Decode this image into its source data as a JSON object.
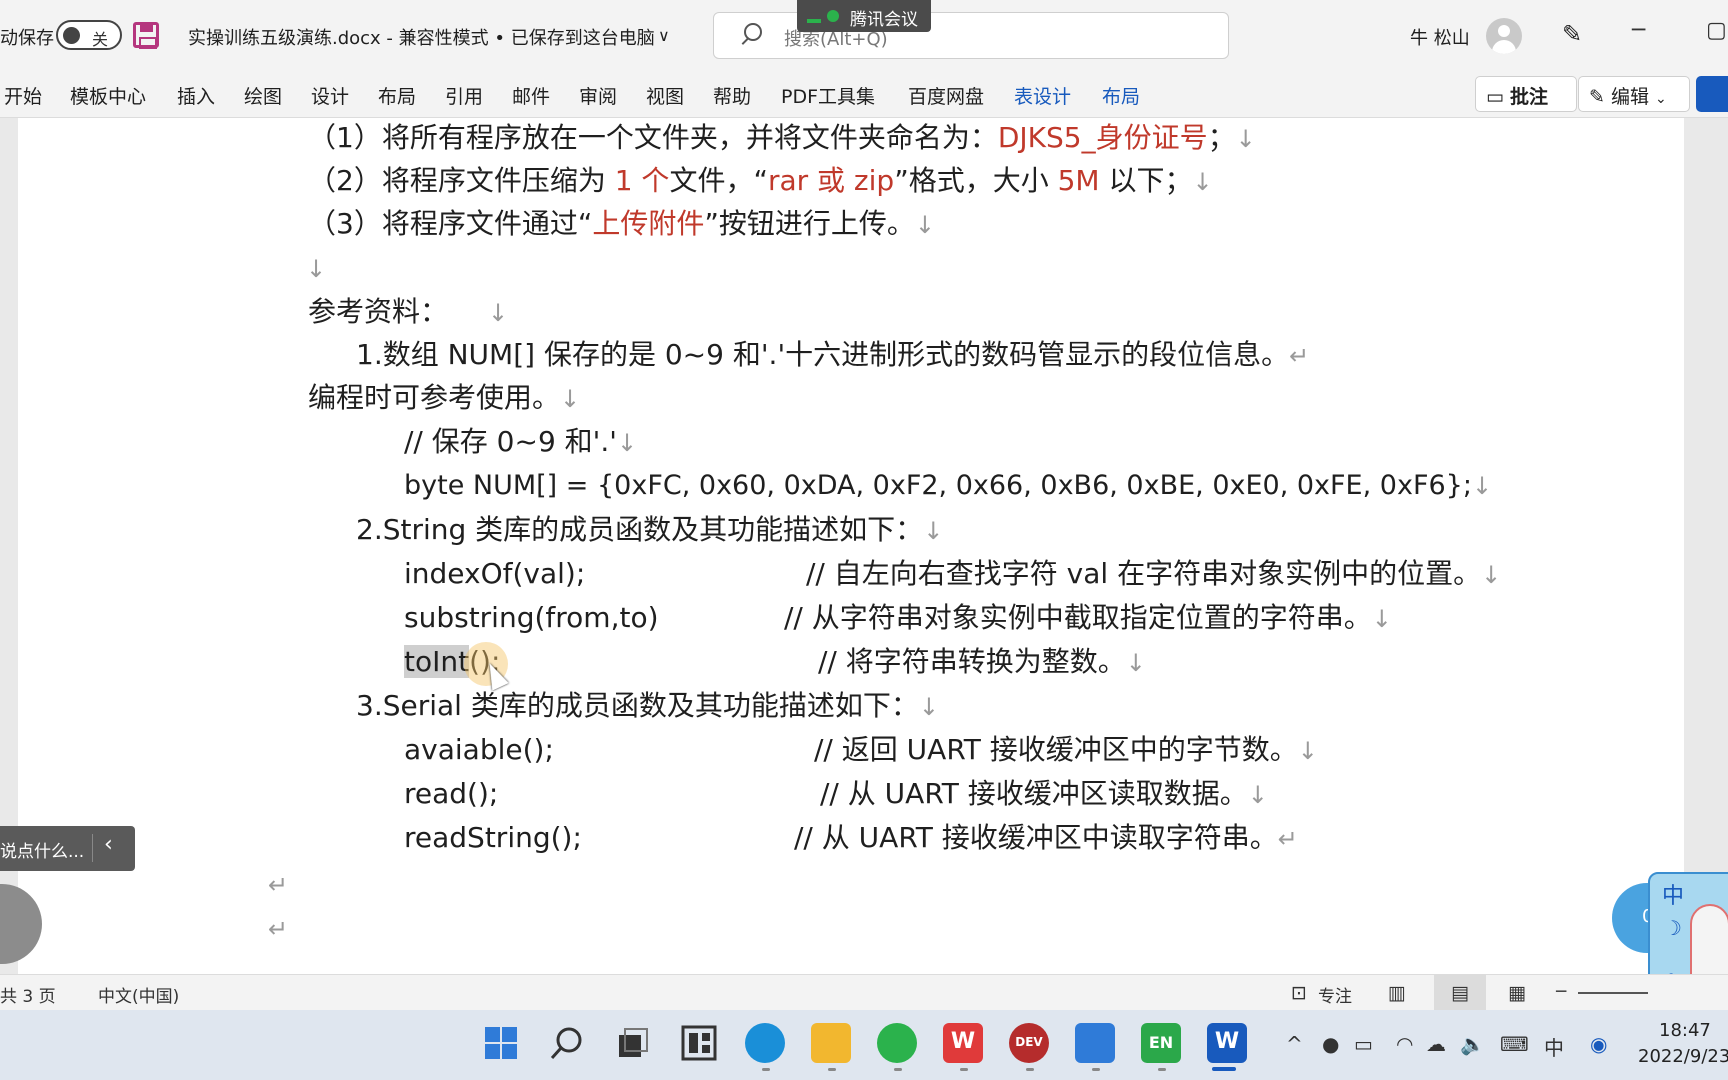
{
  "titlebar": {
    "autosave_label": "动保存",
    "toggle_state": "关",
    "document_title": "实操训练五级演练.docx  -  兼容性模式 • 已保存到这台电脑",
    "title_chevron": "∨",
    "search_placeholder": "搜索(Alt+Q)",
    "meeting_badge": "腾讯会议",
    "user_name": "牛 松山",
    "minimize_glyph": "─",
    "restore_glyph": "▢"
  },
  "ribbon": {
    "tabs": [
      "开始",
      "模板中心",
      "插入",
      "绘图",
      "设计",
      "布局",
      "引用",
      "邮件",
      "审阅",
      "视图",
      "帮助",
      "PDF工具集",
      "百度网盘",
      "表设计",
      "布局"
    ],
    "comments_label": "批注",
    "editing_label": "编辑",
    "editing_chevron": "⌄"
  },
  "document": {
    "req1_prefix": "（1）将所有程序放在一个文件夹，并将文件夹命名为：",
    "req1_red": "DJKS5_身份证号",
    "req1_suffix": "；",
    "req2_prefix": "（2）将程序文件压缩为 ",
    "req2_red1": "1 个",
    "req2_mid1": "文件，“",
    "req2_red2": "rar 或 zip",
    "req2_mid2": "”格式，大小 ",
    "req2_red3": "5M",
    "req2_suffix": " 以下；",
    "req3_prefix": "（3）将程序文件通过“",
    "req3_red": "上传附件",
    "req3_suffix": "”按钮进行上传。",
    "ref_heading": "参考资料：",
    "ref1_line1": "1.数组 NUM[]  保存的是 0~9 和'.'十六进制形式的数码管显示的段位信息。",
    "ref1_line2": "编程时可参考使用。",
    "code_comment": "//  保存 0~9 和'.'",
    "code_array": "byte NUM[] = {0xFC, 0x60, 0xDA, 0xF2, 0x66, 0xB6, 0xBE, 0xE0, 0xFE, 0xF6};",
    "ref2_heading": "2.String 类库的成员函数及其功能描述如下：",
    "string_funcs": [
      {
        "name": "indexOf(val);",
        "desc": "//  自左向右查找字符 val 在字符串对象实例中的位置。"
      },
      {
        "name": "substring(from,to)",
        "desc": "//  从字符串对象实例中截取指定位置的字符串。"
      },
      {
        "name": "toInt",
        "name_rest": "();",
        "desc": "//  将字符串转换为整数。"
      }
    ],
    "ref3_heading": "3.Serial 类库的成员函数及其功能描述如下：",
    "serial_funcs": [
      {
        "name": "avaiable();",
        "desc": "//  返回 UART 接收缓冲区中的字节数。"
      },
      {
        "name": "read();",
        "desc": "//  从 UART 接收缓冲区读取数据。"
      },
      {
        "name": "readString();",
        "desc": "//  从 UART 接收缓冲区中读取字符串。"
      }
    ],
    "line_break_mark": "↓",
    "paragraph_mark": "↵"
  },
  "floating": {
    "comment_pill": "说点什么...",
    "comment_chevron": "‹",
    "timer": "04",
    "ime_zh": "中",
    "ime_moon": "☽",
    "ime_gear": "✿"
  },
  "statusbar": {
    "page_info": "共 3 页",
    "language": "中文(中国)",
    "focus_label": "专注",
    "zoom_minus": "─"
  },
  "taskbar": {
    "apps": [
      {
        "icon": "windows-start-icon",
        "color": "#2f7bd8"
      },
      {
        "icon": "search-icon",
        "color": "#333333"
      },
      {
        "icon": "task-view-icon",
        "color": "#333333"
      },
      {
        "icon": "widgets-icon",
        "color": "#333333"
      },
      {
        "icon": "edge-icon",
        "color": "#1a8fd8"
      },
      {
        "icon": "file-explorer-icon",
        "color": "#f2b72f"
      },
      {
        "icon": "wechat-icon",
        "color": "#2bb24c"
      },
      {
        "icon": "wps-icon",
        "color": "#e03a3a"
      },
      {
        "icon": "devcpp-icon",
        "color": "#b52c2c"
      },
      {
        "icon": "feishu-icon",
        "color": "#2f7bd8"
      },
      {
        "icon": "en-input-icon",
        "color": "#2ba84a"
      },
      {
        "icon": "word-icon",
        "color": "#185abd"
      }
    ],
    "app_glyphs": {
      "devcpp": "DEV",
      "en": "EN",
      "word": "W",
      "wps": "W"
    },
    "tray": {
      "chevron": "^",
      "ime": "中",
      "volume": "🔈"
    },
    "time": "18:47",
    "date": "2022/9/23"
  },
  "colors": {
    "accent_blue": "#185abd",
    "doc_red": "#c0392b",
    "save_icon": "#b5367e"
  }
}
